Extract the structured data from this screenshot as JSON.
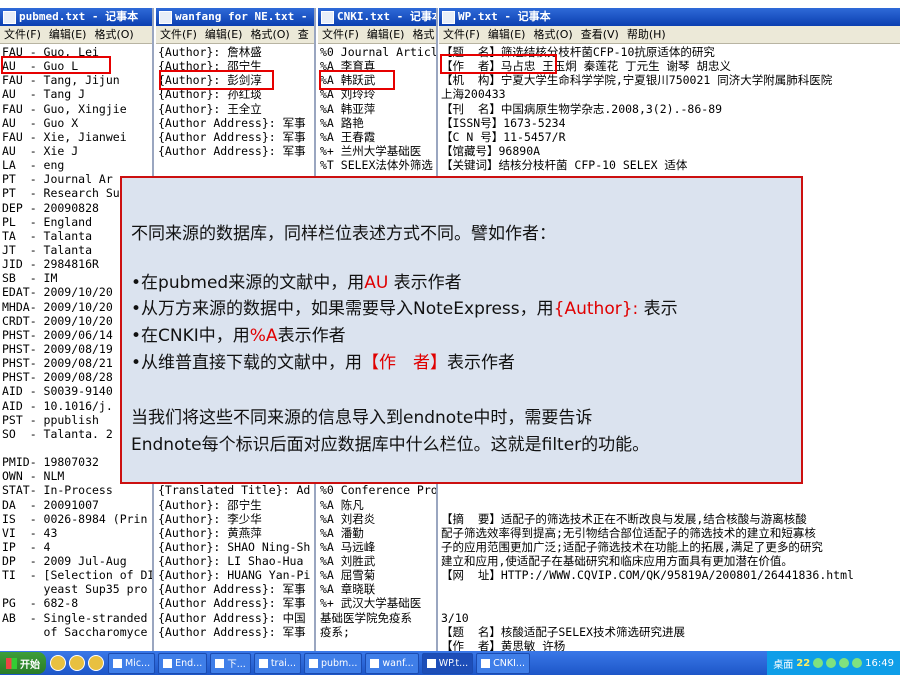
{
  "windows": {
    "pubmed": {
      "title": "pubmed.txt - 记事本",
      "menu": [
        "文件(F)",
        "编辑(E)",
        "格式(O)"
      ],
      "lines": [
        "FAU - Guo, Lei",
        "AU  - Guo L",
        "FAU - Tang, Jijun",
        "AU  - Tang J",
        "FAU - Guo, Xingjie",
        "AU  - Guo X",
        "FAU - Xie, Jianwei",
        "AU  - Xie J",
        "LA  - eng",
        "PT  - Journal Ar",
        "PT  - Research Su",
        "DEP - 20090828",
        "PL  - England",
        "TA  - Talanta",
        "JT  - Talanta",
        "JID - 2984816R",
        "SB  - IM",
        "EDAT- 2009/10/20",
        "MHDA- 2009/10/20",
        "CRDT- 2009/10/20",
        "PHST- 2009/06/14",
        "PHST- 2009/08/19",
        "PHST- 2009/08/21",
        "PHST- 2009/08/28",
        "AID - S0039-9140",
        "AID - 10.1016/j.",
        "PST - ppublish",
        "SO  - Talanta. 2",
        "",
        "PMID- 19807032",
        "OWN - NLM",
        "STAT- In-Process",
        "DA  - 20091007",
        "IS  - 0026-8984 (Prin",
        "VI  - 43",
        "IP  - 4",
        "DP  - 2009 Jul-Aug",
        "TI  - [Selection of DI",
        "      yeast Sup35 pro",
        "PG  - 682-8",
        "AB  - Single-stranded",
        "      of Saccharomyce"
      ]
    },
    "wanfang": {
      "title": "wanfang for NE.txt - 记事",
      "menu": [
        "文件(F)",
        "编辑(E)",
        "格式(O)",
        "查"
      ],
      "lines": [
        "{Author}: 詹林盛",
        "{Author}: 邵宁生",
        "{Author}: 彭剑淳",
        "{Author}: 孙红琰",
        "{Author}: 王全立",
        "{Author Address}: 军事",
        "{Author Address}: 军事",
        "{Author Address}: 军事",
        "",
        "",
        "",
        "",
        "",
        "",
        "",
        "",
        "",
        "",
        "",
        "",
        "",
        "",
        "",
        "",
        "",
        "",
        "",
        "",
        "",
        "",
        "",
        "{Translated Title}: Ad",
        "{Author}: 邵宁生",
        "{Author}: 李少华",
        "{Author}: 黄燕萍",
        "{Author}: SHAO Ning-Sh",
        "{Author}: LI Shao-Hua",
        "{Author}: HUANG Yan-Pi",
        "{Author Address}: 军事",
        "{Author Address}: 军事",
        "{Author Address}: 中国",
        "{Author Address}: 军事"
      ]
    },
    "cnki": {
      "title": "CNKI.txt - 记事本",
      "menu": [
        "文件(F)",
        "编辑(E)",
        "格式"
      ],
      "lines": [
        "%0 Journal Articl",
        "%A 李育真",
        "%A 韩跃武",
        "%A 刘玲玲",
        "%A 韩亚萍",
        "%A 路艳",
        "%A 王春霞",
        "%+ 兰州大学基础医",
        "%T SELEX法体外筛选",
        "",
        "",
        "",
        "",
        "",
        "",
        "",
        "",
        "",
        "",
        "",
        "",
        "",
        "",
        "",
        "",
        "",
        "",
        "",
        "",
        "",
        "",
        "%0 Conference Pro",
        "%A 陈凡",
        "%A 刘君炎",
        "%A 潘勤",
        "%A 马远峰",
        "%A 刘胜武",
        "%A 屈雪菊",
        "%A 章晓联",
        "%+ 武汉大学基础医",
        "基础医学院免疫系",
        "疫系;"
      ]
    },
    "wp": {
      "title": "WP.txt - 记事本",
      "menu": [
        "文件(F)",
        "编辑(E)",
        "格式(O)",
        "查看(V)",
        "帮助(H)"
      ],
      "lines": [
        "【题  名】筛选结核分枝杆菌CFP-10抗原适体的研究",
        "【作  者】马占忠 王玉炯 秦莲花 丁元生 谢琴 胡忠义",
        "【机  构】宁夏大学生命科学学院,宁夏银川750021 同济大学附属肺科医院",
        "上海200433",
        "【刊  名】中国病原生物学杂志.2008,3(2).-86-89",
        "【ISSN号】1673-5234",
        "【C N 号】11-5457/R",
        "【馆藏号】96890A",
        "【关键词】结核分枝杆菌 CFP-10 SELEX 适体",
        "",
        "",
        "适体的方法,并",
        "A) 文库,以微孔",
        "AMAN软件对其结",
        "t assay,ELOSA)",
        "265;克隆子测序",
        "合的结构基础。",
        "",
        "",
        "22451.html",
        "",
        "",
        "",
        "",
        "",
        "",
        "实验室,南昌33",
        "",
        "",
        "",
        "",
        "",
        "",
        "【摘  要】适配子的筛选技术正在不断改良与发展,结合核酸与游离核酸",
        "配子筛选效率得到提高;无引物结合部位适配子的筛选技术的建立和短寡核",
        "子的应用范围更加广泛;适配子筛选技术在功能上的拓展,满足了更多的研究",
        "建立和应用,使适配子在基础研究和临床应用方面具有更加潜在价值。",
        "【网  址】HTTP://WWW.CQVIP.COM/QK/95819A/200801/26441836.html",
        "",
        "",
        "3/10",
        "【题  名】核酸适配子SELEX技术筛选研究进展",
        "【作  者】黄思敏 许杨"
      ]
    }
  },
  "overlay": {
    "intro": "不同来源的数据库，同样栏位表述方式不同。譬如作者：",
    "bullets": [
      {
        "prefix": "•在pubmed来源的文献中，用",
        "highlight": "AU",
        "suffix": " 表示作者"
      },
      {
        "prefix": "•从万方来源的数据中，如果需要导入NoteExpress，用",
        "highlight": "{Author}:",
        "suffix": " 表示"
      },
      {
        "prefix": "•在CNKI中，用",
        "highlight": "%A",
        "suffix": "表示作者"
      },
      {
        "prefix": "•从维普直接下载的文献中，用",
        "highlight": "【作　者】",
        "suffix": "表示作者"
      }
    ],
    "conclusion_1": "当我们将这些不同来源的信息导入到endnote中时，需要告诉",
    "conclusion_2": "Endnote每个标识后面对应数据库中什么栏位。这就是filter的功能。",
    "highlight_color": "#e00000"
  },
  "taskbar": {
    "start": "开始",
    "buttons": [
      "Mic...",
      "End...",
      "下...",
      "trai...",
      "pubm...",
      "wanf...",
      "WP.t...",
      "CNKI..."
    ],
    "desktop": "桌面",
    "tray_count": "22",
    "clock": "16:49"
  }
}
